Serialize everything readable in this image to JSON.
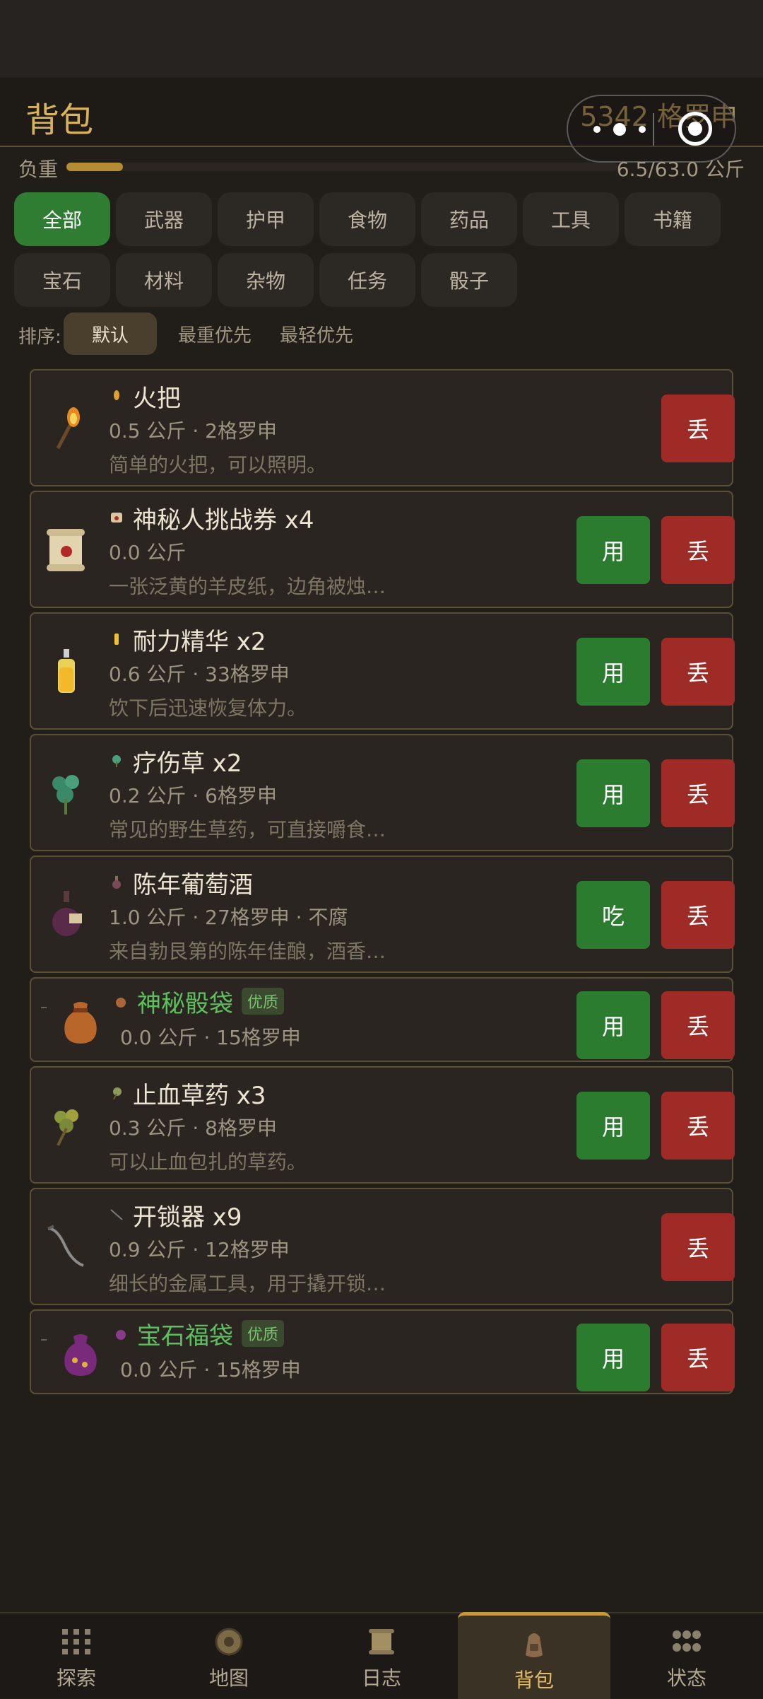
{
  "header": {
    "title": "背包",
    "money": "5342 格罗申"
  },
  "load": {
    "label": "负重",
    "value": "6.5/63.0 公斤",
    "fraction": 0.103
  },
  "categories": [
    "全部",
    "武器",
    "护甲",
    "食物",
    "药品",
    "工具",
    "书籍",
    "宝石",
    "材料",
    "杂物",
    "任务",
    "骰子"
  ],
  "sort": {
    "label": "排序:",
    "options": [
      "默认",
      "最重优先",
      "最轻优先"
    ]
  },
  "items": [
    {
      "name": "火把",
      "meta": "0.5 公斤 · 2格罗申",
      "desc": "简单的火把，可以照明。",
      "drop": "丢",
      "icon": "torch-icon"
    },
    {
      "name": "神秘人挑战券 x4",
      "meta": "0.0 公斤",
      "desc": "一张泛黄的羊皮纸，边角被烛…",
      "use": "用",
      "drop": "丢",
      "icon": "scroll-icon"
    },
    {
      "name": "耐力精华 x2",
      "meta": "0.6 公斤 · 33格罗申",
      "desc": "饮下后迅速恢复体力。",
      "use": "用",
      "drop": "丢",
      "icon": "potion-icon"
    },
    {
      "name": "疗伤草 x2",
      "meta": "0.2 公斤 · 6格罗申",
      "desc": "常见的野生草药，可直接嚼食…",
      "use": "用",
      "drop": "丢",
      "icon": "herb-icon"
    },
    {
      "name": "陈年葡萄酒",
      "meta": "1.0 公斤 · 27格罗申 · 不腐",
      "desc": "来自勃艮第的陈年佳酿，酒香…",
      "use": "吃",
      "drop": "丢",
      "icon": "wine-icon"
    },
    {
      "name": "神秘骰袋",
      "badge": "优质",
      "meta": "0.0 公斤 · 15格罗申",
      "use": "用",
      "drop": "丢",
      "icon": "dice-bag-icon"
    },
    {
      "name": "止血草药 x3",
      "meta": "0.3 公斤 · 8格罗申",
      "desc": "可以止血包扎的草药。",
      "use": "用",
      "drop": "丢",
      "icon": "herb-bundle-icon"
    },
    {
      "name": "开锁器 x9",
      "meta": "0.9 公斤 · 12格罗申",
      "desc": "细长的金属工具，用于撬开锁…",
      "drop": "丢",
      "icon": "lockpick-icon"
    },
    {
      "name": "宝石福袋",
      "badge": "优质",
      "meta": "0.0 公斤 · 15格罗申",
      "use": "用",
      "drop": "丢",
      "icon": "gem-bag-icon"
    }
  ],
  "tabbar": [
    {
      "label": "探索",
      "icon": "explore-icon"
    },
    {
      "label": "地图",
      "icon": "map-icon"
    },
    {
      "label": "日志",
      "icon": "journal-icon"
    },
    {
      "label": "背包",
      "icon": "backpack-icon"
    },
    {
      "label": "状态",
      "icon": "status-icon"
    }
  ],
  "colors": {
    "accent": "#d8b25c",
    "green": "#2f7d32",
    "red": "#9e2b25",
    "quality": "#5ebf5e"
  }
}
